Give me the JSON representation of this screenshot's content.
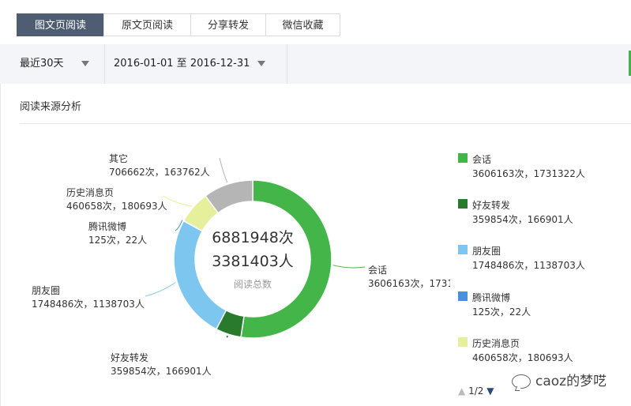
{
  "tabs": [
    {
      "label": "图文页阅读",
      "active": true
    },
    {
      "label": "原文页阅读",
      "active": false
    },
    {
      "label": "分享转发",
      "active": false
    },
    {
      "label": "微信收藏",
      "active": false
    }
  ],
  "filters": {
    "period": "最近30天",
    "date_range": "2016-01-01 至 2016-12-31"
  },
  "section_title": "阅读来源分析",
  "chart_data": {
    "type": "pie",
    "center_total_reads": "6881948次",
    "center_total_users": "3381403人",
    "center_label": "阅读总数",
    "slices": [
      {
        "name": "会话",
        "label": "3606163次，1731322人",
        "reads": 3606163,
        "users": 1731322,
        "color": "#44b549"
      },
      {
        "name": "好友转发",
        "label": "359854次，166901人",
        "reads": 359854,
        "users": 166901,
        "color": "#2a7a2e"
      },
      {
        "name": "朋友圈",
        "label": "1748486次，1138703人",
        "reads": 1748486,
        "users": 1138703,
        "color": "#7cc6ef"
      },
      {
        "name": "腾讯微博",
        "label": "125次，22人",
        "reads": 125,
        "users": 22,
        "color": "#4a90d9"
      },
      {
        "name": "历史消息页",
        "label": "460658次，180693人",
        "reads": 460658,
        "users": 180693,
        "color": "#e6ef9c"
      },
      {
        "name": "其它",
        "label": "706662次，163762人",
        "reads": 706662,
        "users": 163762,
        "color": "#b5b5b5"
      }
    ],
    "legend_placement": "right"
  },
  "legend_items": [
    {
      "name": "会话",
      "value": "3606163次，1731322人",
      "color": "#44b549"
    },
    {
      "name": "好友转发",
      "value": "359854次，166901人",
      "color": "#2a7a2e"
    },
    {
      "name": "朋友圈",
      "value": "1748486次，1138703人",
      "color": "#7cc6ef"
    },
    {
      "name": "腾讯微博",
      "value": "125次，22人",
      "color": "#4a90d9"
    },
    {
      "name": "历史消息页",
      "value": "460658次，180693人",
      "color": "#e6ef9c"
    }
  ],
  "pager": {
    "text": "1/2",
    "up_icon": "triangle-up-icon",
    "down_icon": "triangle-down-icon"
  },
  "watermark": "caoz的梦呓"
}
